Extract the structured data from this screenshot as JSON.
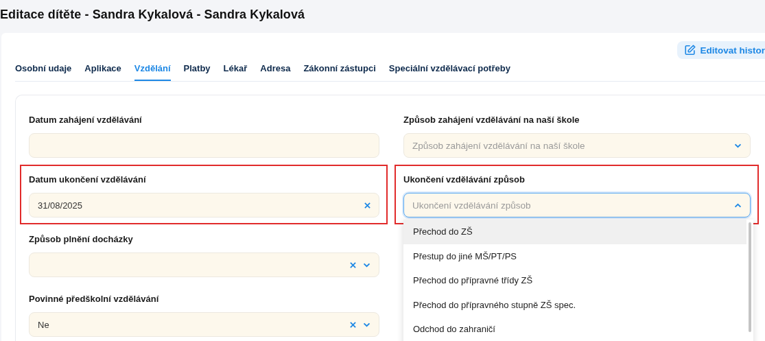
{
  "page_title": "Editace dítěte - Sandra Kykalová - Sandra Kykalová",
  "edit_history_button": "Editovat histor",
  "tabs": [
    {
      "label": "Osobní udaje",
      "selected": false
    },
    {
      "label": "Aplikace",
      "selected": false
    },
    {
      "label": "Vzdělání",
      "selected": true
    },
    {
      "label": "Platby",
      "selected": false
    },
    {
      "label": "Lékař",
      "selected": false
    },
    {
      "label": "Adresa",
      "selected": false
    },
    {
      "label": "Zákonní zástupci",
      "selected": false
    },
    {
      "label": "Speciální vzdělávací potřeby",
      "selected": false
    }
  ],
  "left_column": [
    {
      "label": "Datum zahájení vzdělávání",
      "kind": "date",
      "highlighted": false,
      "clearable": false
    },
    {
      "label": "Datum ukončení vzdělávání",
      "kind": "date",
      "value": "31/08/2025",
      "highlighted": true,
      "clearable": true
    },
    {
      "label": "Způsob plnění docházky",
      "kind": "select",
      "highlighted": false,
      "clearable": true,
      "expanded": false
    },
    {
      "label": "Povinné předškolní vzdělávání",
      "kind": "select",
      "value": "Ne",
      "highlighted": false,
      "clearable": true,
      "expanded": false
    }
  ],
  "right_column": [
    {
      "label": "Způsob zahájení vzdělávání na naší škole",
      "kind": "select",
      "placeholder": "Způsob zahájení vzdělávání na naší škole",
      "highlighted": false,
      "clearable": false,
      "expanded": false
    },
    {
      "label": "Ukončení vzdělávání způsob",
      "kind": "select",
      "placeholder": "Ukončení vzdělávání způsob",
      "highlighted": true,
      "clearable": false,
      "expanded": true,
      "options": [
        {
          "label": "Přechod do ZŠ",
          "selected": true
        },
        {
          "label": "Přestup do jiné MŠ/PT/PS",
          "selected": false
        },
        {
          "label": "Přechod do přípravné třídy ZŠ",
          "selected": false
        },
        {
          "label": "Přechod do přípravného stupně ZŠ spec.",
          "selected": false
        },
        {
          "label": "Odchod do zahraničí",
          "selected": false
        }
      ]
    }
  ]
}
